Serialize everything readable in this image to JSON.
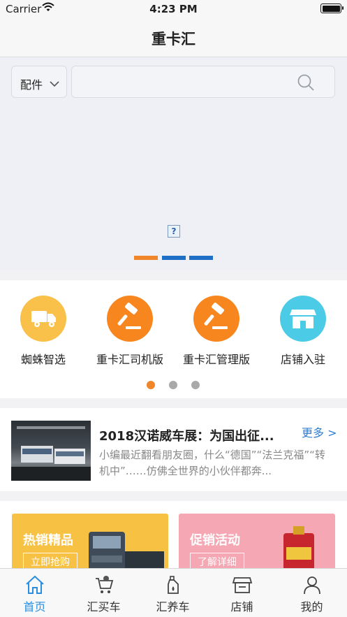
{
  "status_bar": {
    "carrier": "Carrier",
    "time": "4:23 PM"
  },
  "nav": {
    "title": "重卡汇"
  },
  "search": {
    "category": "配件",
    "placeholder": ""
  },
  "banner": {
    "broken_image_glyph": "?",
    "indicator_colors": [
      "#f0852a",
      "#1f6fc6",
      "#1f6fc6"
    ]
  },
  "functions": {
    "items": [
      {
        "label": "蜘蛛智选",
        "icon": "truck-icon",
        "color": "#f9c14a"
      },
      {
        "label": "重卡汇司机版",
        "icon": "gavel-icon",
        "color": "#f7861f"
      },
      {
        "label": "重卡汇管理版",
        "icon": "gavel-icon",
        "color": "#f7861f"
      },
      {
        "label": "店铺入驻",
        "icon": "store-icon",
        "color": "#4ccbe6"
      }
    ],
    "page_dots": {
      "count": 3,
      "active": 0,
      "active_color": "#f0852a",
      "inactive_color": "#a9a9a9"
    }
  },
  "news": {
    "title": "2018汉诺威车展：为国出征...",
    "more": "更多 >",
    "desc": "小编最近翻看朋友圈，什么“德国”“法兰克福”“转机中”……仿佛全世界的小伙伴都奔..."
  },
  "promos": [
    {
      "title": "热销精品",
      "button": "立即抢购",
      "color": "#f7c244"
    },
    {
      "title": "促销活动",
      "button": "了解详细",
      "color": "#f5a7b3"
    }
  ],
  "tabs": [
    {
      "label": "首页",
      "icon": "home-icon",
      "active": true
    },
    {
      "label": "汇买车",
      "icon": "cart-icon",
      "active": false
    },
    {
      "label": "汇养车",
      "icon": "oil-bottle-icon",
      "active": false
    },
    {
      "label": "店铺",
      "icon": "shop-icon",
      "active": false
    },
    {
      "label": "我的",
      "icon": "person-icon",
      "active": false
    }
  ],
  "colors": {
    "accent": "#2a8ee0",
    "link": "#2d7dd2"
  }
}
